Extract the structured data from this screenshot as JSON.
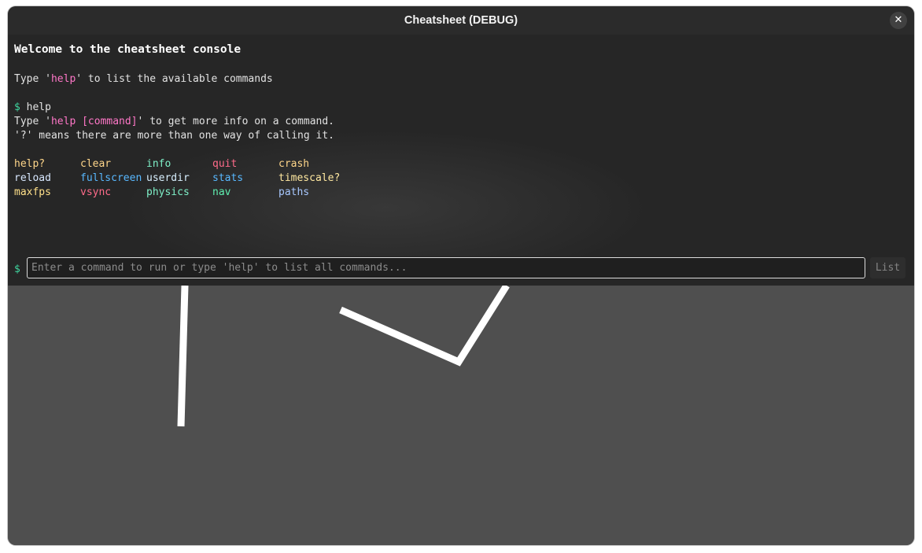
{
  "window": {
    "title": "Cheatsheet (DEBUG)",
    "close_glyph": "✕"
  },
  "console": {
    "welcome": "Welcome to the cheatsheet console",
    "hint_prefix": "Type '",
    "hint_keyword": "help",
    "hint_suffix": "' to list the available commands",
    "prompt_symbol": "$",
    "entered_command": "help",
    "help_line1_prefix": "Type '",
    "help_line1_keyword": "help [command]",
    "help_line1_suffix": "' to get more info on a command.",
    "help_line2": "'?' means there are more than one way of calling it.",
    "commands": [
      {
        "name": "help?",
        "color": "#ffd68a"
      },
      {
        "name": "clear",
        "color": "#ffd68a"
      },
      {
        "name": "info",
        "color": "#7ff0c8"
      },
      {
        "name": "quit",
        "color": "#ff6b8a"
      },
      {
        "name": "crash",
        "color": "#ffd68a"
      },
      {
        "name": "reload",
        "color": "#d8e8ff"
      },
      {
        "name": "fullscreen",
        "color": "#58b8ff"
      },
      {
        "name": "userdir",
        "color": "#d8f0ff"
      },
      {
        "name": "stats",
        "color": "#58b8ff"
      },
      {
        "name": "timescale?",
        "color": "#ffe8a0"
      },
      {
        "name": "maxfps",
        "color": "#ffe08a"
      },
      {
        "name": "vsync",
        "color": "#ff6b8a"
      },
      {
        "name": "physics",
        "color": "#7ff0c8"
      },
      {
        "name": "nav",
        "color": "#5ff0b0"
      },
      {
        "name": "paths",
        "color": "#a8c8ff"
      }
    ]
  },
  "input": {
    "prompt_symbol": "$",
    "placeholder": "Enter a command to run or type 'help' to list all commands...",
    "value": "",
    "list_button": "List"
  },
  "colors": {
    "accent_highlight": "#ff77c8",
    "prompt": "#3fd7a0",
    "console_bg": "#262626",
    "game_bg": "#4f4f4f"
  }
}
